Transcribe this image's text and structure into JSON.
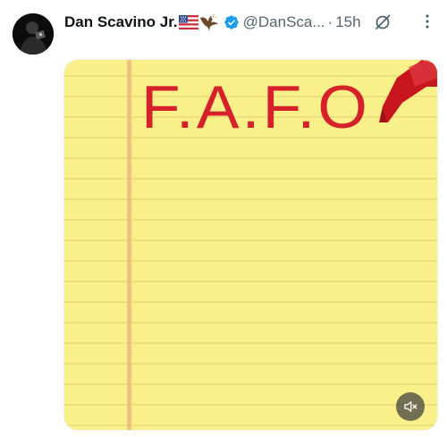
{
  "author": {
    "name": "Dan Scavino Jr.",
    "handle": "@DanSca...",
    "separator": "·",
    "time": "15h",
    "name_emojis": [
      "us-flag-icon",
      "eagle-icon"
    ],
    "verified_icon": "verified-badge-icon",
    "avatar_icon": "avatar"
  },
  "media": {
    "text": "F.A.F.O",
    "text_color": "#d6202a",
    "paper_color": "#faf08a",
    "line_color": "#e3d673",
    "margin_line_color": "#f0b980",
    "mute_icon": "mute-icon"
  },
  "icons": {
    "grok": "grok-icon",
    "more": "more-options-icon"
  },
  "colors": {
    "name": "#0f1419",
    "secondary": "#536471",
    "verified": "#1d9bf0"
  }
}
